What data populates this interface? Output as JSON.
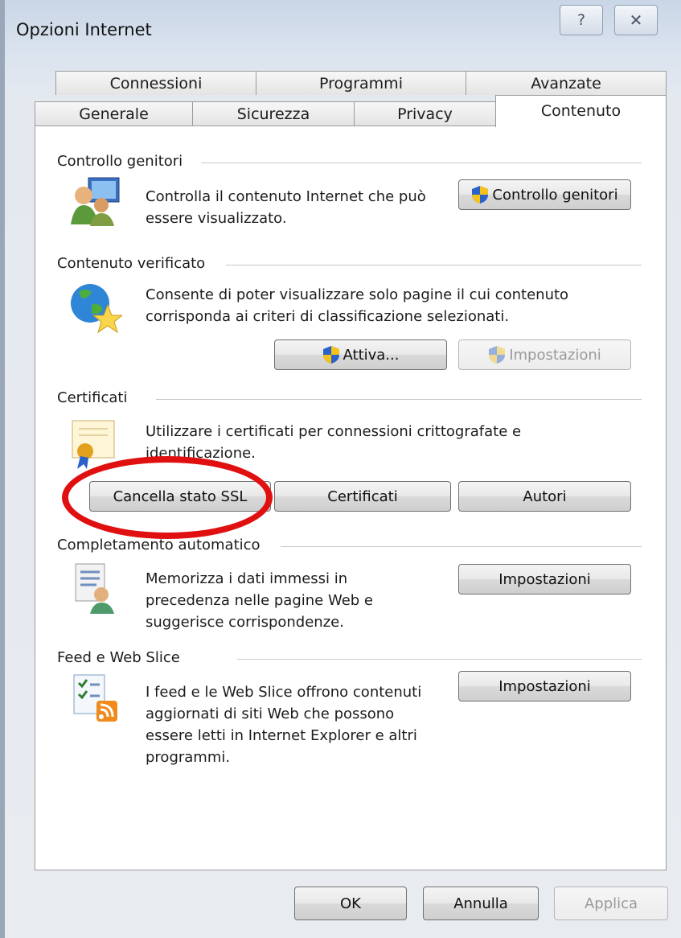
{
  "window": {
    "title": "Opzioni Internet",
    "help_glyph": "?",
    "close_glyph": "✕"
  },
  "tabs": {
    "row_back": [
      "Connessioni",
      "Programmi",
      "Avanzate"
    ],
    "row_front": [
      "Generale",
      "Sicurezza",
      "Privacy",
      "Contenuto"
    ],
    "active": "Contenuto"
  },
  "groups": {
    "parental": {
      "heading": "Controllo genitori",
      "description": "Controlla il contenuto Internet che può essere visualizzato.",
      "desc_line1": "Controlla il contenuto Internet che può",
      "desc_line2": "essere visualizzato.",
      "button": "Controllo genitori"
    },
    "rated": {
      "heading": "Contenuto verificato",
      "desc_line1": "Consente di poter visualizzare solo pagine il cui contenuto",
      "desc_line2": "corrisponda ai criteri di classificazione selezionati.",
      "enable_button": "Attiva...",
      "settings_button": "Impostazioni"
    },
    "certificates": {
      "heading": "Certificati",
      "desc_line1": "Utilizzare i certificati per connessioni crittografate e",
      "desc_line2": "identificazione.",
      "clear_ssl_button": "Cancella stato SSL",
      "certificates_button": "Certificati",
      "publishers_button": "Autori"
    },
    "autocomplete": {
      "heading": "Completamento automatico",
      "desc_line1": "Memorizza i dati immessi in",
      "desc_line2": "precedenza nelle pagine Web e",
      "desc_line3": "suggerisce corrispondenze.",
      "settings_button": "Impostazioni"
    },
    "feeds": {
      "heading": "Feed e Web Slice",
      "desc_line1": "I feed e le Web Slice offrono contenuti",
      "desc_line2": "aggiornati di siti Web che possono",
      "desc_line3": "essere letti in Internet Explorer e altri",
      "desc_line4": "programmi.",
      "settings_button": "Impostazioni"
    }
  },
  "footer": {
    "ok": "OK",
    "cancel": "Annulla",
    "apply": "Applica"
  },
  "colors": {
    "highlight_ring": "#e01010",
    "shield_blue": "#2a62c9",
    "shield_yellow": "#f4c21a"
  }
}
